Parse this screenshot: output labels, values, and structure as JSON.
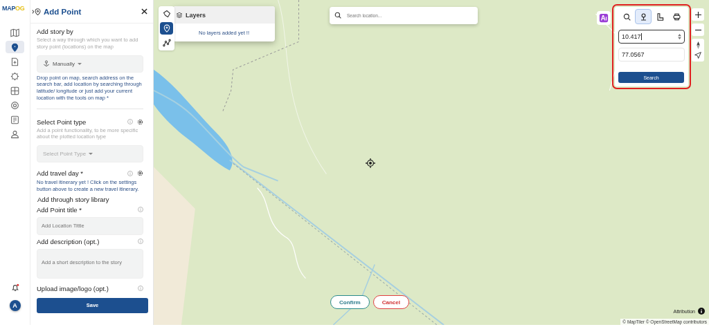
{
  "brand": {
    "logo_main": "MAP",
    "logo_accent": "OG"
  },
  "rail": {
    "items": [
      {
        "selected": false
      },
      {
        "selected": true
      },
      {
        "selected": false
      },
      {
        "selected": false
      },
      {
        "selected": false
      },
      {
        "selected": false
      },
      {
        "selected": false
      },
      {
        "selected": false
      }
    ],
    "notification_unread": true,
    "avatar": "A"
  },
  "panel": {
    "title": "Add Point",
    "story_by": {
      "label": "Add story by",
      "hint": "Select a way through which you want to add story point (locations) on the map",
      "dropdown": "Manually",
      "note": "Drop point on map, search address on the search bar, add location by searching through latitude/ longitude or just add your current location with the tools on map *"
    },
    "point_type": {
      "label": "Select Point type",
      "hint": "Add a point functionality, to be more specific about the plotted location type",
      "placeholder": "Select Point Type"
    },
    "travel_day": {
      "label": "Add travel day *",
      "note": "No travel itinerary yet ! Click on the settings button above to create a new travel itinerary."
    },
    "library_link": "Add through story library",
    "point_title": {
      "label": "Add Point title *",
      "placeholder": "Add Location Tittle"
    },
    "description": {
      "label": "Add description (opt.)",
      "placeholder": "Add a short description to the story"
    },
    "upload": {
      "label": "Upload image/logo (opt.)"
    },
    "save": "Save"
  },
  "map": {
    "tools": [
      {
        "selected": false
      },
      {
        "selected": true
      },
      {
        "selected": false
      }
    ],
    "layers": {
      "title": "Layers",
      "empty": "No layers added yet !!"
    },
    "search": {
      "placeholder": "Search location..."
    },
    "coordinate_panel": {
      "highlighted": true,
      "tabs": [
        {
          "selected": false
        },
        {
          "selected": true
        },
        {
          "selected": false
        },
        {
          "selected": false
        }
      ],
      "latitude": "10.417",
      "longitude": "77.0567",
      "button": "Search"
    },
    "confirm": "Confirm",
    "cancel": "Cancel",
    "attribution": "Attribution",
    "credits": "© MapTiler © OpenStreetMap contributors"
  }
}
